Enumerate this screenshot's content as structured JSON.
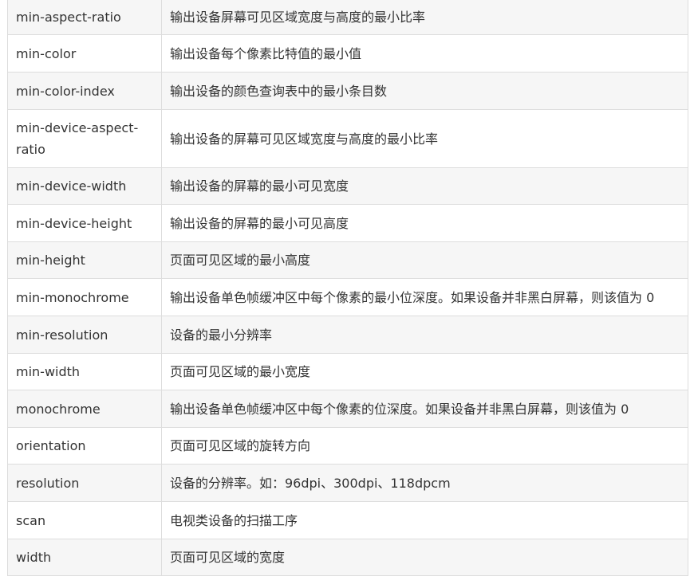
{
  "rows": [
    {
      "property": "min-aspect-ratio",
      "description": "输出设备屏幕可见区域宽度与高度的最小比率"
    },
    {
      "property": "min-color",
      "description": "输出设备每个像素比特值的最小值"
    },
    {
      "property": "min-color-index",
      "description": "输出设备的颜色查询表中的最小条目数"
    },
    {
      "property": "min-device-aspect-ratio",
      "description": "输出设备的屏幕可见区域宽度与高度的最小比率"
    },
    {
      "property": "min-device-width",
      "description": "输出设备的屏幕的最小可见宽度"
    },
    {
      "property": "min-device-height",
      "description": "输出设备的屏幕的最小可见高度"
    },
    {
      "property": "min-height",
      "description": "页面可见区域的最小高度"
    },
    {
      "property": "min-monochrome",
      "description": "输出设备单色帧缓冲区中每个像素的最小位深度。如果设备并非黑白屏幕，则该值为 0"
    },
    {
      "property": "min-resolution",
      "description": "设备的最小分辨率"
    },
    {
      "property": "min-width",
      "description": "页面可见区域的最小宽度"
    },
    {
      "property": "monochrome",
      "description": "输出设备单色帧缓冲区中每个像素的位深度。如果设备并非黑白屏幕，则该值为 0"
    },
    {
      "property": "orientation",
      "description": "页面可见区域的旋转方向"
    },
    {
      "property": "resolution",
      "description": "设备的分辨率。如：96dpi、300dpi、118dpcm"
    },
    {
      "property": "scan",
      "description": "电视类设备的扫描工序"
    },
    {
      "property": "width",
      "description": "页面可见区域的宽度"
    }
  ]
}
